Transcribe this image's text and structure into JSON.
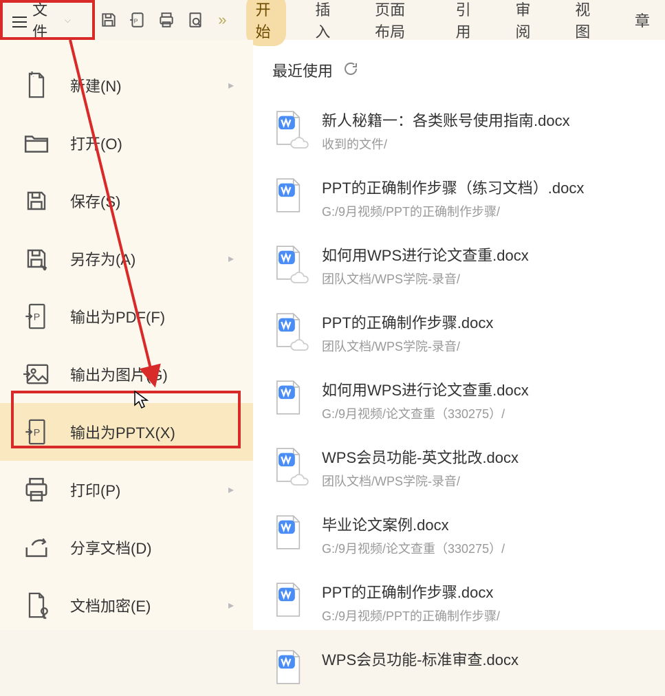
{
  "toolbar": {
    "file_label": "文件",
    "more": "»"
  },
  "tabs": [
    {
      "label": "开始",
      "active": true
    },
    {
      "label": "插入",
      "active": false
    },
    {
      "label": "页面布局",
      "active": false
    },
    {
      "label": "引用",
      "active": false
    },
    {
      "label": "审阅",
      "active": false
    },
    {
      "label": "视图",
      "active": false
    },
    {
      "label": "章",
      "active": false
    }
  ],
  "sidebar": {
    "items": [
      {
        "label": "新建(N)",
        "arrow": true,
        "selected": false,
        "icon": "new-file"
      },
      {
        "label": "打开(O)",
        "arrow": false,
        "selected": false,
        "icon": "open-folder"
      },
      {
        "label": "保存(S)",
        "arrow": false,
        "selected": false,
        "icon": "save"
      },
      {
        "label": "另存为(A)",
        "arrow": true,
        "selected": false,
        "icon": "save-as"
      },
      {
        "label": "输出为PDF(F)",
        "arrow": false,
        "selected": false,
        "icon": "export-pdf"
      },
      {
        "label": "输出为图片(G)",
        "arrow": false,
        "selected": false,
        "icon": "export-image"
      },
      {
        "label": "输出为PPTX(X)",
        "arrow": false,
        "selected": true,
        "icon": "export-pptx"
      },
      {
        "label": "打印(P)",
        "arrow": true,
        "selected": false,
        "icon": "print"
      },
      {
        "label": "分享文档(D)",
        "arrow": false,
        "selected": false,
        "icon": "share"
      },
      {
        "label": "文档加密(E)",
        "arrow": true,
        "selected": false,
        "icon": "encrypt"
      }
    ]
  },
  "content": {
    "recent_label": "最近使用",
    "files": [
      {
        "name": "新人秘籍一：各类账号使用指南.docx",
        "path": "收到的文件/",
        "cloud": true
      },
      {
        "name": "PPT的正确制作步骤（练习文档）.docx",
        "path": "G:/9月视频/PPT的正确制作步骤/",
        "cloud": false
      },
      {
        "name": "如何用WPS进行论文查重.docx",
        "path": "团队文档/WPS学院-录音/",
        "cloud": true
      },
      {
        "name": "PPT的正确制作步骤.docx",
        "path": "团队文档/WPS学院-录音/",
        "cloud": true
      },
      {
        "name": "如何用WPS进行论文查重.docx",
        "path": "G:/9月视频/论文查重（330275）/",
        "cloud": false
      },
      {
        "name": "WPS会员功能-英文批改.docx",
        "path": "团队文档/WPS学院-录音/",
        "cloud": true
      },
      {
        "name": "毕业论文案例.docx",
        "path": "G:/9月视频/论文查重（330275）/",
        "cloud": false
      },
      {
        "name": "PPT的正确制作步骤.docx",
        "path": "G:/9月视频/PPT的正确制作步骤/",
        "cloud": false
      },
      {
        "name": "WPS会员功能-标准审查.docx",
        "path": "",
        "cloud": false
      }
    ]
  },
  "annotations": {
    "highlight_file_button": true,
    "highlight_pptx_item": true,
    "arrow_from_file_to_pptx": true
  }
}
